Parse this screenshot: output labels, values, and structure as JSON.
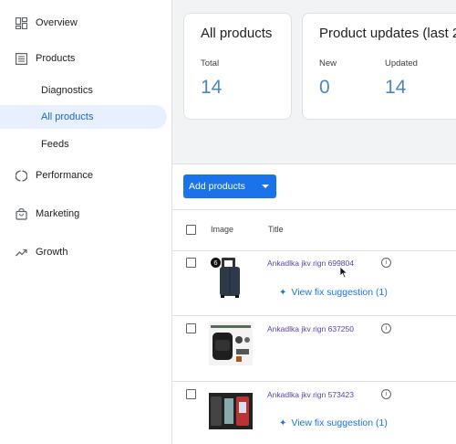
{
  "sidebar": {
    "items": [
      {
        "label": "Overview"
      },
      {
        "label": "Products"
      },
      {
        "label": "Performance"
      },
      {
        "label": "Marketing"
      },
      {
        "label": "Growth"
      }
    ],
    "sub_items": [
      {
        "label": "Diagnostics"
      },
      {
        "label": "All products"
      },
      {
        "label": "Feeds"
      }
    ]
  },
  "cards": {
    "all_products": {
      "title": "All products",
      "total_label": "Total",
      "total_value": "14"
    },
    "updates": {
      "title": "Product updates (last 2",
      "new_label": "New",
      "new_value": "0",
      "updated_label": "Updated",
      "updated_value": "14"
    }
  },
  "toolbar": {
    "add_label": "Add products"
  },
  "table": {
    "headers": {
      "image": "Image",
      "title": "Title"
    },
    "rows": [
      {
        "badge": "6",
        "title": "Ankadlka jkv rign 699804",
        "fix": "View fix suggestion (1)"
      },
      {
        "title": "Ankadlka jkv rign 637250"
      },
      {
        "title": "Ankadlka jkv rign 573423",
        "fix": "View fix suggestion (1)"
      }
    ]
  },
  "colors": {
    "accent": "#1a73e8",
    "value": "#4a86c8",
    "link": "#5b3fa6",
    "active_bg": "#e8f0fe"
  }
}
